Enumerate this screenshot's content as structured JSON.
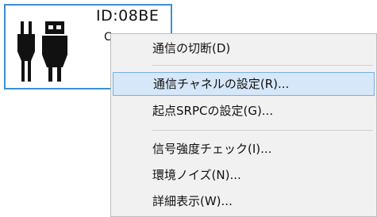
{
  "device": {
    "id_label": "ID:08BE",
    "sub_label": "C"
  },
  "menu": {
    "items": [
      {
        "label": "通信の切断(D)"
      },
      {
        "label": "通信チャネルの設定(R)..."
      },
      {
        "label": "起点SRPCの設定(G)..."
      },
      {
        "label": "信号強度チェック(I)..."
      },
      {
        "label": "環境ノイズ(N)..."
      },
      {
        "label": "詳細表示(W)..."
      }
    ],
    "highlighted_index": 1
  },
  "colors": {
    "tile_border": "#3c8fd6",
    "menu_background": "#f1f1f1",
    "highlight_background": "#d5e7f8",
    "highlight_border": "#78aee5",
    "icon_fill": "#111111"
  },
  "icons": {
    "device_icon": "plug-connector-icon"
  }
}
